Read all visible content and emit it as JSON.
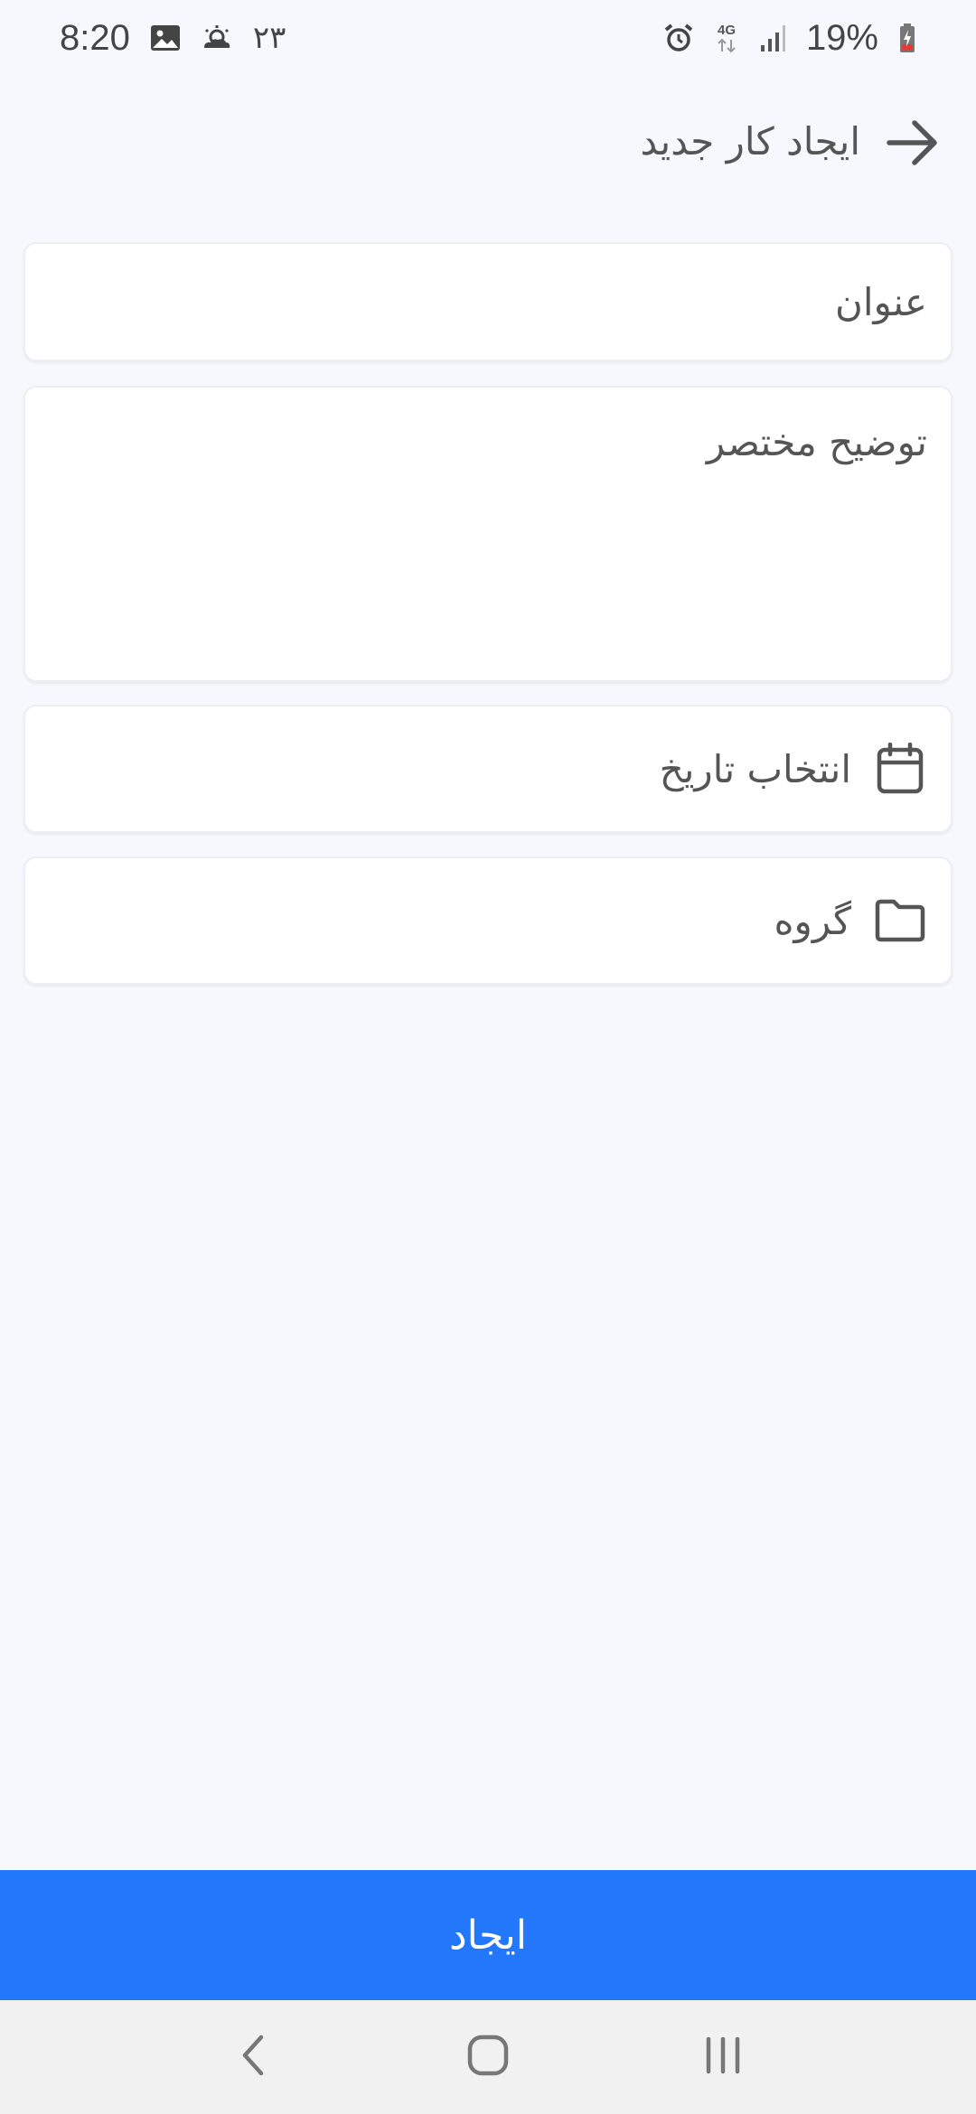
{
  "status_bar": {
    "time": "8:20",
    "temperature": "۲۳",
    "battery": "19%",
    "network": "4G",
    "icons": [
      "gallery-icon",
      "weather-icon",
      "alarm-icon",
      "4g-data-icon",
      "signal-icon",
      "battery-charging-icon"
    ]
  },
  "app_bar": {
    "title": "ایجاد کار جدید",
    "back_icon": "arrow-right-icon"
  },
  "form": {
    "title_placeholder": "عنوان",
    "description_placeholder": "توضیح مختصر",
    "date_label": "انتخاب تاریخ",
    "date_icon": "calendar-icon",
    "group_label": "گروه",
    "group_icon": "folder-icon"
  },
  "actions": {
    "create_label": "ایجاد"
  },
  "nav_bar": {
    "icons": [
      "back-nav-icon",
      "home-nav-icon",
      "recents-nav-icon"
    ]
  },
  "colors": {
    "background": "#f6f8fd",
    "accent": "#2277fa",
    "text": "#555555",
    "nav_bar": "#f1f1f1"
  }
}
